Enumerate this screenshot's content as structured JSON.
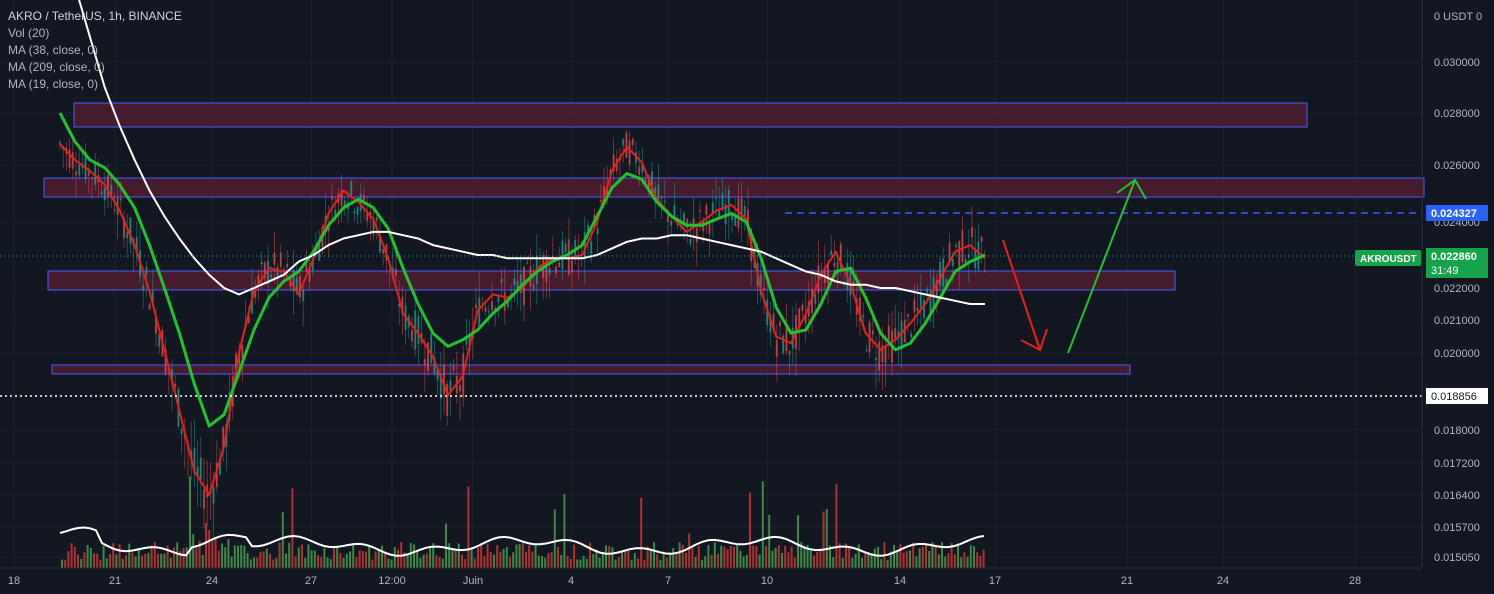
{
  "header": {
    "title": "AKRO / TetherUS, 1h, BINANCE",
    "indicators": [
      "Vol (20)",
      "MA (38, close, 0)",
      "MA (209, close, 0)",
      "MA (19, close, 0)"
    ]
  },
  "colors": {
    "background": "#131722",
    "grid": "#1e222d",
    "text": "#b2b5be",
    "candle_up": "#26a69a",
    "candle_down": "#ef5350",
    "vol_up": "#4caf50",
    "vol_down": "#e53935",
    "ma19": "#e8201a",
    "ma38": "#22c22e",
    "ma209": "#ffffff",
    "zone_fill": "#5a1d33",
    "zone_border": "#4a5cff",
    "price_badge": "#16a34a",
    "dashed_level": "#2962ff"
  },
  "chart_data": {
    "type": "line",
    "title": "AKRO / TetherUS, 1h, BINANCE",
    "axis_top_label": "0 USDT 0",
    "x_ticks": [
      "18",
      "21",
      "24",
      "27",
      "12:00",
      "Juin",
      "4",
      "7",
      "10",
      "14",
      "17",
      "21",
      "24",
      "28"
    ],
    "y_ticks": [
      "0.030000",
      "0.028000",
      "0.026000",
      "0.024000",
      "0.022000",
      "0.021000",
      "0.020000",
      "0.018000",
      "0.017200",
      "0.016400",
      "0.015700",
      "0.015050"
    ],
    "current_price": {
      "symbol": "AKROUSDT",
      "value": "0.022860",
      "countdown": "31:49"
    },
    "levels": [
      {
        "label": "0.024327",
        "style": "dashed-blue"
      },
      {
        "label": "0.018856",
        "style": "dotted-white"
      }
    ],
    "series": [
      {
        "indicator": "MA (19, close, 0)",
        "color": "#e8201a",
        "values": [
          0.0268,
          0.0262,
          0.0258,
          0.0253,
          0.0244,
          0.0233,
          0.0219,
          0.0201,
          0.0185,
          0.017,
          0.0164,
          0.0176,
          0.02,
          0.0219,
          0.0226,
          0.0225,
          0.0218,
          0.0229,
          0.0243,
          0.0251,
          0.0247,
          0.0241,
          0.0229,
          0.0212,
          0.0206,
          0.0199,
          0.0189,
          0.0194,
          0.0213,
          0.0218,
          0.0217,
          0.022,
          0.0226,
          0.0229,
          0.0229,
          0.023,
          0.024,
          0.0258,
          0.0267,
          0.0261,
          0.0248,
          0.0242,
          0.0237,
          0.024,
          0.0244,
          0.0246,
          0.0241,
          0.0219,
          0.0205,
          0.0203,
          0.0212,
          0.0224,
          0.0231,
          0.0221,
          0.0206,
          0.0201,
          0.0204,
          0.0209,
          0.0215,
          0.0223,
          0.0231,
          0.0233,
          0.0229
        ]
      },
      {
        "indicator": "MA (38, close, 0)",
        "color": "#22c22e",
        "values": [
          0.028,
          0.0269,
          0.0262,
          0.0259,
          0.0253,
          0.0245,
          0.0233,
          0.022,
          0.0206,
          0.0192,
          0.0181,
          0.0184,
          0.0195,
          0.0207,
          0.0217,
          0.0222,
          0.0225,
          0.0231,
          0.0239,
          0.0245,
          0.0248,
          0.0245,
          0.0238,
          0.0226,
          0.0215,
          0.0206,
          0.0202,
          0.0204,
          0.0207,
          0.0212,
          0.0216,
          0.0221,
          0.0225,
          0.0228,
          0.023,
          0.0233,
          0.0242,
          0.0252,
          0.0257,
          0.0255,
          0.0247,
          0.0242,
          0.0239,
          0.0239,
          0.0241,
          0.0243,
          0.024,
          0.0229,
          0.0214,
          0.0206,
          0.0207,
          0.0215,
          0.0225,
          0.0226,
          0.0217,
          0.0206,
          0.0201,
          0.0203,
          0.0209,
          0.0217,
          0.0225,
          0.0228,
          0.023
        ]
      },
      {
        "indicator": "MA (209, close, 0)",
        "color": "#ffffff",
        "values": [
          0.0345,
          0.033,
          0.031,
          0.029,
          0.0275,
          0.0262,
          0.0251,
          0.0242,
          0.0235,
          0.0229,
          0.0224,
          0.022,
          0.0218,
          0.022,
          0.0222,
          0.0224,
          0.0228,
          0.023,
          0.0233,
          0.0235,
          0.0236,
          0.0237,
          0.0237,
          0.0236,
          0.0235,
          0.0233,
          0.0232,
          0.0231,
          0.023,
          0.023,
          0.0229,
          0.0229,
          0.0229,
          0.0229,
          0.0229,
          0.0229,
          0.023,
          0.0232,
          0.0234,
          0.0235,
          0.0235,
          0.0236,
          0.0236,
          0.0235,
          0.0234,
          0.0233,
          0.0232,
          0.0231,
          0.0229,
          0.0227,
          0.0225,
          0.0224,
          0.0222,
          0.0221,
          0.0221,
          0.022,
          0.022,
          0.0219,
          0.0218,
          0.0217,
          0.0216,
          0.0215,
          0.0215
        ]
      }
    ]
  }
}
